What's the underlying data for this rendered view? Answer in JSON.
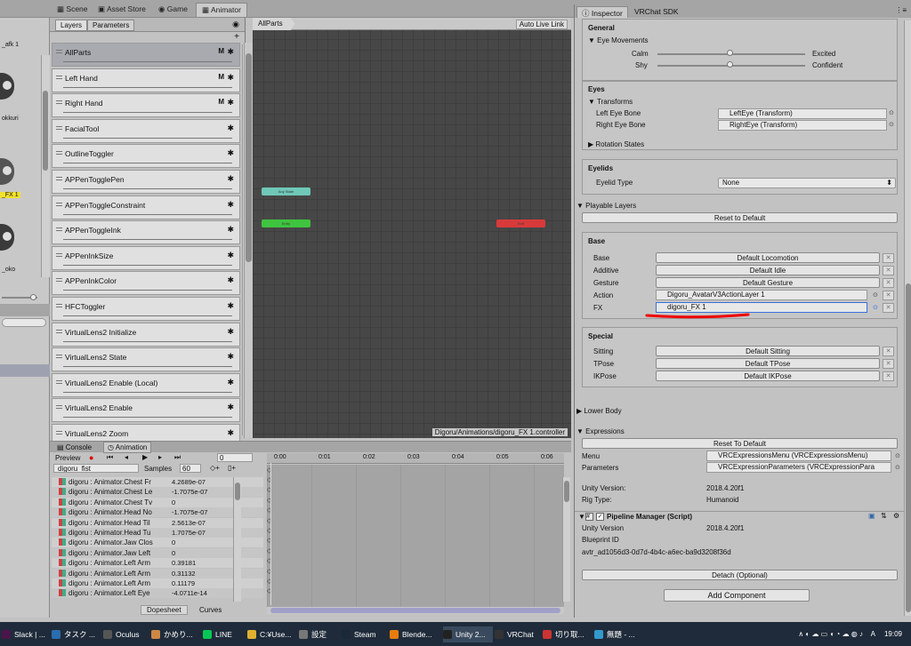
{
  "top_tabs": {
    "scene": "Scene",
    "asset_store": "Asset Store",
    "game": "Game",
    "animator": "Animator"
  },
  "left_strip": {
    "label1": "_afk 1",
    "label2": "okkuri",
    "label3": "_FX 1",
    "label4": "_oko"
  },
  "layers_panel": {
    "tab_layers": "Layers",
    "tab_parameters": "Parameters",
    "plus": "+",
    "items": [
      {
        "label": "AllParts",
        "m": "M",
        "selected": true
      },
      {
        "label": "Left Hand",
        "m": "M"
      },
      {
        "label": "Right Hand",
        "m": "M"
      },
      {
        "label": "FacialTool",
        "m": ""
      },
      {
        "label": "OutlineToggler",
        "m": ""
      },
      {
        "label": "APPenTogglePen",
        "m": ""
      },
      {
        "label": "APPenToggleConstraint",
        "m": ""
      },
      {
        "label": "APPenToggleInk",
        "m": ""
      },
      {
        "label": "APPenInkSize",
        "m": ""
      },
      {
        "label": "APPenInkColor",
        "m": ""
      },
      {
        "label": "HFCToggler",
        "m": ""
      },
      {
        "label": "VirtualLens2 Initialize",
        "m": ""
      },
      {
        "label": "VirtualLens2 State",
        "m": ""
      },
      {
        "label": "VirtualLens2 Enable (Local)",
        "m": ""
      },
      {
        "label": "VirtualLens2 Enable",
        "m": ""
      },
      {
        "label": "VirtualLens2 Zoom",
        "m": ""
      }
    ]
  },
  "graph": {
    "breadcrumb": "AllParts",
    "auto_live_link": "Auto Live Link",
    "path": "Digoru/Animations/digoru_FX 1.controller",
    "node_any": "Any State",
    "node_entry": "Entry",
    "node_exit": "Exit",
    "color_any": "#6fc8b8",
    "color_entry": "#3ec43e",
    "color_exit": "#d83a3a"
  },
  "animation": {
    "tab_console": "Console",
    "tab_animation": "Animation",
    "preview": "Preview",
    "frame": "0",
    "clip": "digoru_fist",
    "samples_label": "Samples",
    "samples": "60",
    "times": [
      "0:00",
      "0:01",
      "0:02",
      "0:03",
      "0:04",
      "0:05",
      "0:06"
    ],
    "dopesheet": "Dopesheet",
    "curves": "Curves",
    "keyframe": "◇",
    "props": [
      {
        "name": "digoru : Animator.Chest Fr",
        "value": "4.2689e-07"
      },
      {
        "name": "digoru : Animator.Chest Le",
        "value": "-1.7075e-07"
      },
      {
        "name": "digoru : Animator.Chest Tv",
        "value": "0"
      },
      {
        "name": "digoru : Animator.Head No",
        "value": "-1.7075e-07"
      },
      {
        "name": "digoru : Animator.Head Til",
        "value": "2.5613e-07"
      },
      {
        "name": "digoru : Animator.Head Tu",
        "value": "1.7075e-07"
      },
      {
        "name": "digoru : Animator.Jaw Clos",
        "value": "0"
      },
      {
        "name": "digoru : Animator.Jaw Left",
        "value": "0"
      },
      {
        "name": "digoru : Animator.Left Arm",
        "value": "0.39181"
      },
      {
        "name": "digoru : Animator.Left Arm",
        "value": "0.31132"
      },
      {
        "name": "digoru : Animator.Left Arm",
        "value": "0.11179"
      },
      {
        "name": "digoru : Animator.Left Eye",
        "value": "-4.0711e-14"
      }
    ]
  },
  "inspector": {
    "tab_inspector": "Inspector",
    "tab_sdk": "VRChat SDK",
    "general": "General",
    "eye_movements": "Eye Movements",
    "calm": "Calm",
    "excited": "Excited",
    "shy": "Shy",
    "confident": "Confident",
    "eyes": "Eyes",
    "transforms": "Transforms",
    "left_eye_bone": "Left Eye Bone",
    "left_eye_val": "LeftEye (Transform)",
    "right_eye_bone": "Right Eye Bone",
    "right_eye_val": "RightEye (Transform)",
    "rotation_states": "Rotation States",
    "eyelids": "Eyelids",
    "eyelid_type": "Eyelid Type",
    "eyelid_val": "None",
    "playable_layers": "Playable Layers",
    "reset_default": "Reset to Default",
    "base_header": "Base",
    "base_rows": [
      {
        "label": "Base",
        "value": "Default Locomotion"
      },
      {
        "label": "Additive",
        "value": "Default Idle"
      },
      {
        "label": "Gesture",
        "value": "Default Gesture"
      }
    ],
    "action_label": "Action",
    "action_val": "Digoru_AvatarV3ActionLayer 1",
    "fx_label": "FX",
    "fx_val": "digoru_FX 1",
    "special_header": "Special",
    "special_rows": [
      {
        "label": "Sitting",
        "value": "Default Sitting"
      },
      {
        "label": "TPose",
        "value": "Default TPose"
      },
      {
        "label": "IKPose",
        "value": "Default IKPose"
      }
    ],
    "lower_body": "Lower Body",
    "expressions": "Expressions",
    "reset_to_default": "Reset To Default",
    "menu_label": "Menu",
    "menu_val": "VRCExpressionsMenu (VRCExpressionsMenu)",
    "params_label": "Parameters",
    "params_val": "VRCExpressionParameters (VRCExpressionPara",
    "unity_version_label": "Unity Version:",
    "unity_version": "2018.4.20f1",
    "rig_type_label": "Rig Type:",
    "rig_type": "Humanoid",
    "pipeline": "Pipeline Manager (Script)",
    "pm_unity_label": "Unity Version",
    "pm_unity": "2018.4.20f1",
    "blueprint_label": "Blueprint ID",
    "blueprint": "avtr_ad1056d3-0d7d-4b4c-a6ec-ba9d3208f36d",
    "detach": "Detach (Optional)",
    "add_component": "Add Component"
  },
  "taskbar": {
    "items": [
      {
        "label": "Slack | ...",
        "color": "#4a154b"
      },
      {
        "label": "タスク ...",
        "color": "#2a6db0"
      },
      {
        "label": "Oculus",
        "color": "#555"
      },
      {
        "label": "かめり...",
        "color": "#c84"
      },
      {
        "label": "LINE",
        "color": "#06c755"
      },
      {
        "label": "C:¥Use...",
        "color": "#e0b030"
      },
      {
        "label": "設定",
        "color": "#777"
      },
      {
        "label": "Steam",
        "color": "#1b2838"
      },
      {
        "label": "Blende...",
        "color": "#e87d0d"
      },
      {
        "label": "Unity 2...",
        "color": "#222"
      },
      {
        "label": "VRChat",
        "color": "#333"
      },
      {
        "label": "切り取...",
        "color": "#c33"
      },
      {
        "label": "無題 - ...",
        "color": "#39c"
      }
    ],
    "lang": "A",
    "time": "19:09"
  }
}
